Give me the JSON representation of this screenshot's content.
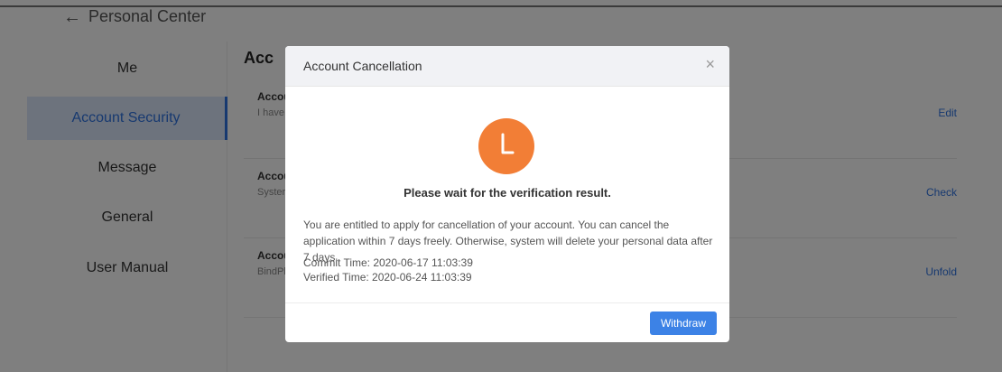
{
  "header": {
    "back_label": "Personal Center"
  },
  "sidebar": {
    "items": [
      {
        "label": "Me",
        "active": false
      },
      {
        "label": "Account Security",
        "active": true
      },
      {
        "label": "Message",
        "active": false
      },
      {
        "label": "General",
        "active": false
      },
      {
        "label": "User Manual",
        "active": false
      }
    ]
  },
  "main": {
    "title": "Acc",
    "rows": [
      {
        "label": "Accou",
        "sub": "I have",
        "action": "Edit"
      },
      {
        "label": "Accou",
        "sub": "Syster",
        "action": "Check"
      },
      {
        "label": "Accou",
        "sub": "BindPl",
        "action": "Unfold"
      }
    ]
  },
  "modal": {
    "title": "Account Cancellation",
    "close_icon": "×",
    "result_title": "Please wait for the verification result.",
    "description": "You are entitled to apply for cancellation of your account. You can cancel the application within 7 days freely. Otherwise, system will delete your personal data after 7 days.",
    "commit_time": "Commit Time: 2020-06-17 11:03:39",
    "verified_time": "Verified Time: 2020-06-24 11:03:39",
    "withdraw_label": "Withdraw"
  },
  "colors": {
    "accent": "#2f73e0",
    "clock": "#f27e36",
    "button": "#3c82e6",
    "active_bg": "#dbe7fb"
  }
}
